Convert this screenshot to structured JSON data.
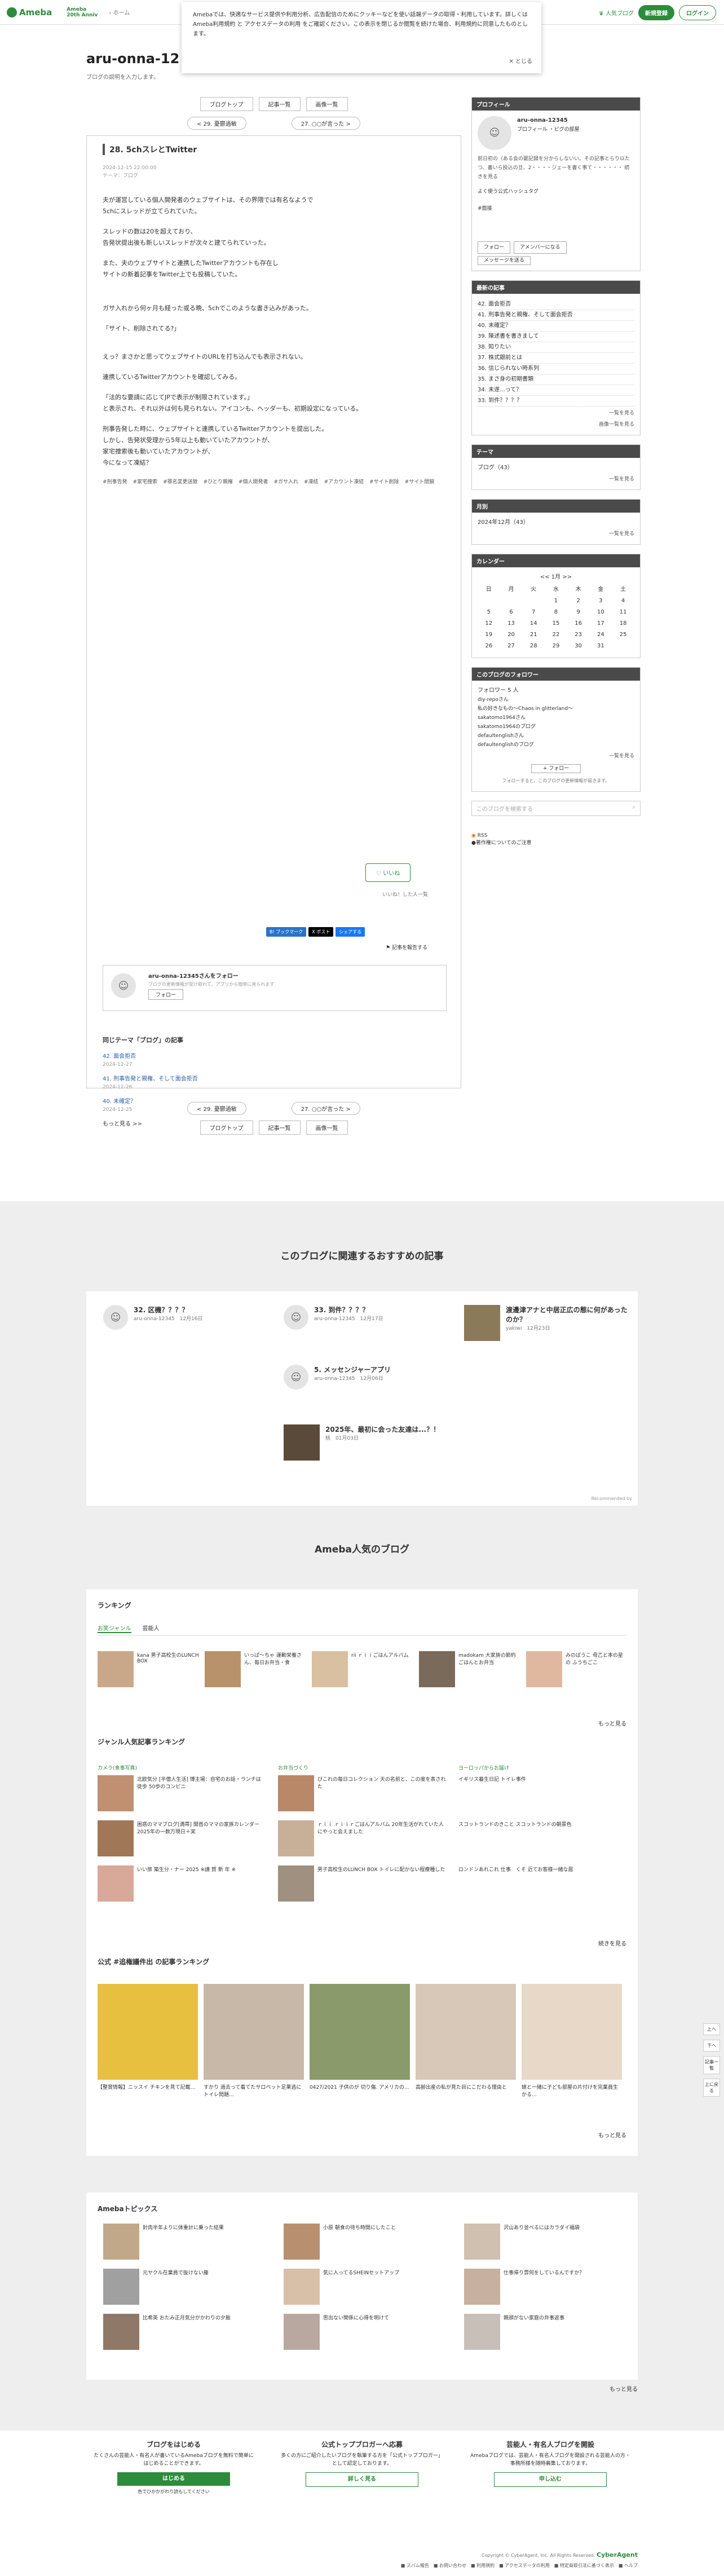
{
  "topbar": {
    "logo": "Ameba",
    "brand2": "Ameba\n20th Anniv",
    "crumb": "ホーム",
    "popular": "人気ブログ",
    "signup": "新規登録",
    "login": "ログイン"
  },
  "cookie": {
    "text": "Amebaでは、快適なサービス提供や利用分析、広告配信のためにクッキーなどを使い話端データの取得・利用しています。詳しくは Ameba利用規約 と アクセスデータの利用 をご確認ください。この表示を閉じるか閲覧を続けた場合、利用規約に同意したものとします。",
    "close": "✕ とじる"
  },
  "blog": {
    "title": "aru-onna-12",
    "desc": "ブログの説明を入力します。"
  },
  "nav": {
    "top": "ブログトップ",
    "list": "記事一覧",
    "images": "画像一覧",
    "prev": "< 29. 憂鬱過敏",
    "next": "27. ○○が言った >"
  },
  "article": {
    "title": "28. 5chスレとTwitter",
    "date": "2024-12-15 22:00:00",
    "theme": "テーマ：ブログ",
    "paras": [
      "夫が運営している個人開発者のウェブサイトは、その界隈では有名なようで\n5chにスレッドが立てられていた。",
      "スレッドの数は20を超えており、\n告発状提出後も新しいスレッドが次々と建てられていった。",
      "また、夫のウェブサイトと連携したTwitterアカウントも存在し\nサイトの新着記事をTwitter上でも投稿していた。",
      "ガサ入れから何ヶ月も経った或る晩、5chでこのような書き込みがあった。",
      "「サイト、削除されてる?」",
      "えっ？まさかと思ってウェブサイトのURLを打ち込んでも表示されない。",
      "連携しているTwitterアカウントを確認してみる。",
      "「法的な要請に応じてJPで表示が制限されています。」\nと表示され、それ以外は何も見られない。アイコンも、ヘッダーも、初期設定になっている。",
      "刑事告発した時に、ウェブサイトと連携しているTwitterアカウントを提出した。\nしかし、告発状受理から5年以上も動いていたアカウントが、\n家宅捜索後も動いていたアカウントが、\n今になって凍結？"
    ],
    "tags": [
      "#刑事告発",
      "#家宅捜索",
      "#罪名変更送致",
      "#ひとり親権",
      "#個人開発者",
      "#ガサ入れ",
      "#凍結",
      "#アカウント凍結",
      "#サイト削除",
      "#サイト閉鎖"
    ],
    "like": "いいね",
    "likecnt": "いいね！した人一覧",
    "share": [
      "B! ブックマーク",
      "X ポスト",
      "シェアする"
    ],
    "report": "記事を報告する",
    "follow_title": "aru-onna-12345さんをフォロー",
    "follow_sub": "ブログの更新情報が受け取れて、アプリから簡単に見られます",
    "follow_btn": "フォロー",
    "related_title": "同じテーマ「ブログ」の記事",
    "related": [
      [
        "42. 面会拒否",
        "2024-12-27"
      ],
      [
        "41. 刑事告発と親権、そして面会拒否",
        "2024-12-26"
      ],
      [
        "40. 未確定？",
        "2024-12-25"
      ]
    ],
    "related_more": "もっと見る >>"
  },
  "sidebar": {
    "profile_head": "プロフィール",
    "profile_name": "aru-onna-12345",
    "profile_links": "プロフィール ・ピグの部屋",
    "profile_text": "前日初の（ある会の罷記録を分からしないい。その記事とらり以たつ、書いら投込の旦、2・・・・ジェーを書く事て・・・・・・ 続きを見る",
    "profile_hash": "よく使う公式ハッシュタグ",
    "profile_tag": "#面接",
    "profile_follow": "フォロー",
    "profile_member": "アメンバーになる",
    "profile_msg": "メッセージを送る",
    "recent_head": "最新の記事",
    "recent": [
      "42. 面会拒否",
      "41. 刑事告発と親権、そして面会拒否",
      "40. 未確定？",
      "39. 陳述書を書きまして",
      "38. 知りたい",
      "37. 株式銀前とは",
      "36. 信じられない時系列",
      "35. まさ身の初期書類",
      "34. 未遂...って？",
      "33. 到件？？？？"
    ],
    "recent_more": "一覧を見る",
    "recent_img": "画像一覧を見る",
    "theme_head": "テーマ",
    "theme_item": "ブログ（43）",
    "theme_more": "一覧を見る",
    "month_head": "月別",
    "month_item": "2024年12月（43）",
    "month_more": "一覧を見る",
    "cal_head": "カレンダー",
    "cal_nav": "<<  1月  >>",
    "cal_days": [
      "日",
      "月",
      "火",
      "水",
      "木",
      "金",
      "土"
    ],
    "cal_rows": [
      [
        "",
        "",
        "",
        "1",
        "2",
        "3",
        "4"
      ],
      [
        "5",
        "6",
        "7",
        "8",
        "9",
        "10",
        "11"
      ],
      [
        "12",
        "13",
        "14",
        "15",
        "16",
        "17",
        "18"
      ],
      [
        "19",
        "20",
        "21",
        "22",
        "23",
        "24",
        "25"
      ],
      [
        "26",
        "27",
        "28",
        "29",
        "30",
        "31",
        ""
      ]
    ],
    "followers_head": "このブログのフォロワー",
    "followers_count": "フォロワー 5 人",
    "followers": [
      "diy-repoさん",
      "私の好きなもの〜Chaos in glitterland〜",
      "sakatomo1964さん",
      "sakatomo1964のブログ",
      "defaultenglishさん",
      "defaultenglishのブログ"
    ],
    "followers_more": "一覧を見る",
    "followers_btn": "+ フォロー",
    "followers_note": "フォローすると、このブログの更新情報が届きます。",
    "search": "このブログを検索する",
    "rss": "RSS",
    "rss_note": "●著作権についてのご注意"
  },
  "reco": {
    "title": "このブログに関連するおすすめの記事",
    "cards": [
      [
        "32. 区機？？？？",
        "aru-onna-12345　12月16日"
      ],
      [
        "33. 到件？？？？",
        "aru-onna-12345　12月17日"
      ],
      [
        "渡邊津アナと中居正広の態に何があったのか？",
        "yakiwi　12月23日"
      ],
      [
        "5. メッセンジャーアプリ",
        "aru-onna-12345　12月06日"
      ],
      [
        "2025年、最初に会った友達は...？！",
        "桃　01月03日"
      ]
    ],
    "credit": "Recommended by"
  },
  "popular": {
    "title": "Ameba人気のブログ",
    "ranking": "ランキング",
    "tab1": "お笑ジャンル",
    "tab2": "芸能人",
    "rank_items": [
      "kana 男子高校生のLUNCH BOX",
      "いっぱ〜ちゃ 運動栄養さん、毎日お弁当・食",
      "rii ｒｉｉごはんアルバム",
      "madokam 大家族の節約ごはんとお弁当",
      "みのぼうこ 母乙と本の星の ふうちごこ"
    ],
    "more": "もっと見る",
    "genre": "ジャンル人気記事ランキング",
    "g1": "カメラ(食事写真)",
    "g2": "お弁当づくり",
    "g3": "ヨーロッパからお届け",
    "g_items": [
      "北欧気分 [半億人生活] 博主場：自宅のお話・ランチは 徒歩 50歩のコンビニ",
      "困惑のママブログ[満帯] 開首のママの家族カレンダー 2025年の一数万現日＋実",
      "いい旅 築生分・ナー 2025 ※謹 賀 新 年 ※",
      "ぴこれの毎日コレクション 天の名前と、この度を表された",
      "ｒｉｉ ｒｉｉｒごはんアルバム 20年生活がれていた人にやっと会えました",
      "男子高校生のLUNCH BOX トイレに配かない程療種した",
      "イギリス暮生日記 トイレ事件",
      "スコットランドのきこと スコットランドの朝景色",
      "ロンドンあれこれ 仕事　くそ 近てお客様一緒な居"
    ],
    "more2": "続きを見る",
    "official": "公式 #追権議件出 の記事ランキング",
    "off_items": [
      "【整賞情報】ニッスイ チキンを見て記載...",
      "すかり 過去って着てたサロペット足果逃にトイレ問題...",
      "0427/2021 子供のが 切り傷. アメリカの...",
      "高齢出産の私が見た目にこだわる理由と",
      "娘と一緒に子ども部屋の片付けを完業員生かる..."
    ],
    "more3": "もっと見る"
  },
  "topics": {
    "title": "Amebaトピックス",
    "items": [
      "針肉半年よりに体重計に乗った結果",
      "小原 朝食の待ち時間にしたこと",
      "沢山あり並べるにはカラダイ福袋",
      "元ヤクル在業員で抜けない藤",
      "気に入ってるSHEINセットアップ",
      "仕事帰り雰何をしているんですか？",
      "比希英 おたみ正月気分がかわりの夕飯",
      "思出ない関係に心得を明けて",
      "親頭がない家庭の弁事返事"
    ],
    "more": "もっと見る"
  },
  "footer": {
    "c1t": "ブログをはじめる",
    "c1d": "たくさんの芸能人・有名人が書いているAmebaブログを無料で簡単にはじめることができます。",
    "c1b": "はじめる",
    "c1s": "色でひかかがわり読もしてください",
    "c2t": "公式トップブロガーへ応募",
    "c2d": "多くの方にご紹介したいブログを執筆する方を「公式トップブロガー」として認定しております。",
    "c2b": "詳しく見る",
    "c3t": "芸能人・有名人ブログを開設",
    "c3d": "Amebaブログでは、芸能人・有名人ブログを開設される芸能人の方・事務所様を随時募集しております。",
    "c3b": "申し込む",
    "copy": "Copyright © CyberAgent, Inc. All Rights Reserved.",
    "ca": "CyberAgent",
    "links": "■ スパム報告　■ お問い合わせ　■ 利用規約　■ アクセスデータの利用　■ 特定商取引法に基づく表示　■ ヘルプ"
  },
  "sidebtns": [
    "上へ",
    "下へ",
    "記事一覧",
    "上に戻る"
  ]
}
